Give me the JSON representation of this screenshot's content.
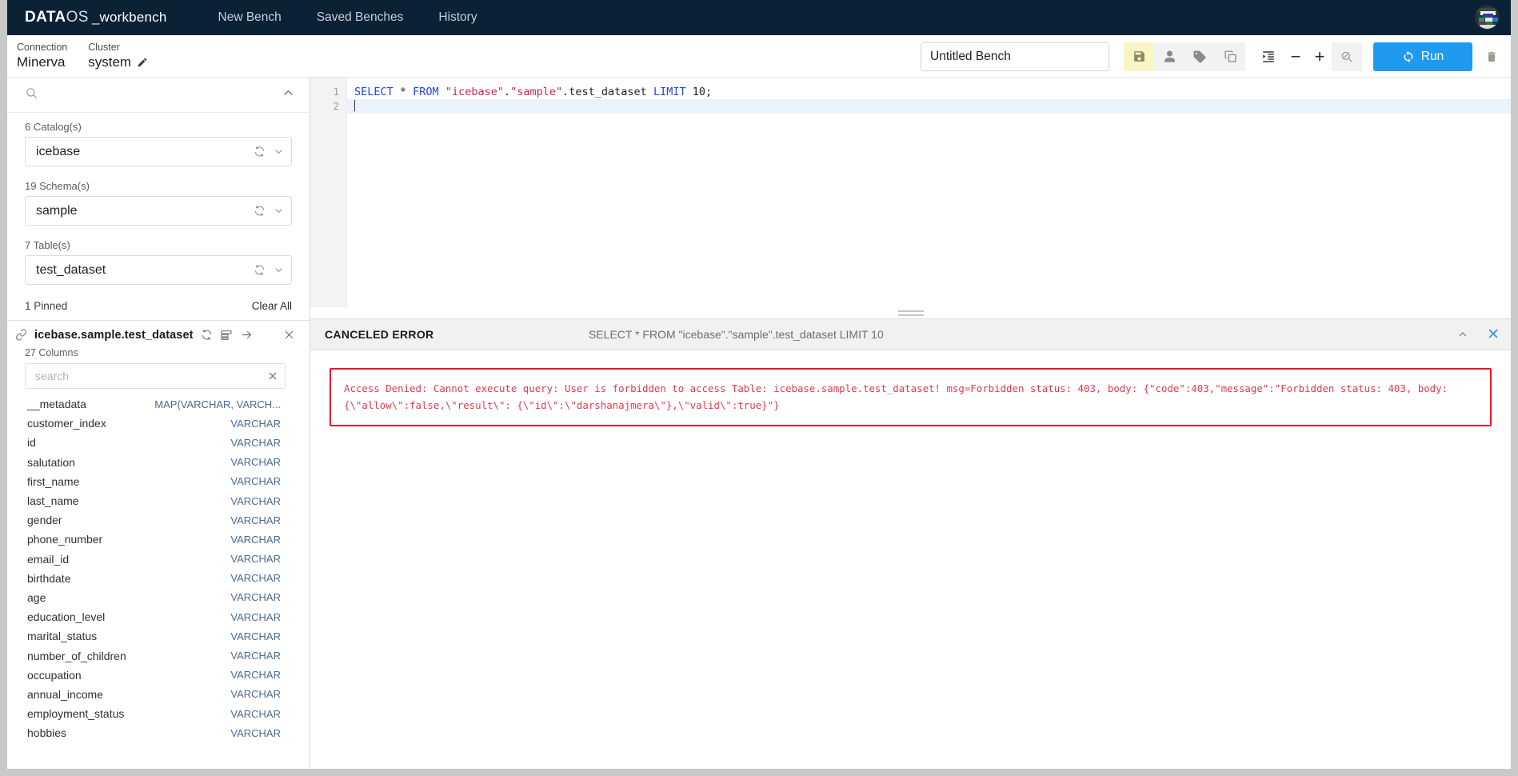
{
  "navbar": {
    "brand_data": "DATA",
    "brand_os": "OS",
    "brand_workbench": "_workbench",
    "links": [
      {
        "label": "New Bench"
      },
      {
        "label": "Saved Benches"
      },
      {
        "label": "History"
      }
    ],
    "avatar_name": "user-avatar"
  },
  "toolbar": {
    "connection_label": "Connection",
    "connection_value": "Minerva",
    "cluster_label": "Cluster",
    "cluster_value": "system",
    "bench_name_value": "Untitled Bench",
    "bench_name_placeholder": "Untitled Bench",
    "run_label": "Run",
    "icons": {
      "save": "save-icon",
      "share": "person-icon",
      "tag": "tag-icon",
      "copy": "copy-icon",
      "format": "format-indent-icon",
      "zoom_out": "minus-icon",
      "zoom_in": "plus-icon",
      "search_off": "search-off-icon",
      "run": "refresh-icon",
      "delete": "trash-icon"
    },
    "zoom_out_glyph": "−",
    "zoom_in_glyph": "+"
  },
  "sidebar": {
    "search_placeholder": "",
    "catalog": {
      "label": "6 Catalog(s)",
      "value": "icebase"
    },
    "schema": {
      "label": "19 Schema(s)",
      "value": "sample"
    },
    "table": {
      "label": "7 Table(s)",
      "value": "test_dataset"
    },
    "pinned_count": "1 Pinned",
    "clear_all": "Clear All",
    "pinned_table": {
      "name": "icebase.sample.test_dataset",
      "columns_count": "27 Columns",
      "search_placeholder": "search",
      "search_value": ""
    },
    "columns": [
      {
        "name": "__metadata",
        "type": "MAP(VARCHAR, VARCH..."
      },
      {
        "name": "customer_index",
        "type": "VARCHAR"
      },
      {
        "name": "id",
        "type": "VARCHAR"
      },
      {
        "name": "salutation",
        "type": "VARCHAR"
      },
      {
        "name": "first_name",
        "type": "VARCHAR"
      },
      {
        "name": "last_name",
        "type": "VARCHAR"
      },
      {
        "name": "gender",
        "type": "VARCHAR"
      },
      {
        "name": "phone_number",
        "type": "VARCHAR"
      },
      {
        "name": "email_id",
        "type": "VARCHAR"
      },
      {
        "name": "birthdate",
        "type": "VARCHAR"
      },
      {
        "name": "age",
        "type": "VARCHAR"
      },
      {
        "name": "education_level",
        "type": "VARCHAR"
      },
      {
        "name": "marital_status",
        "type": "VARCHAR"
      },
      {
        "name": "number_of_children",
        "type": "VARCHAR"
      },
      {
        "name": "occupation",
        "type": "VARCHAR"
      },
      {
        "name": "annual_income",
        "type": "VARCHAR"
      },
      {
        "name": "employment_status",
        "type": "VARCHAR"
      },
      {
        "name": "hobbies",
        "type": "VARCHAR"
      }
    ]
  },
  "editor": {
    "line_numbers": [
      "1",
      "2"
    ],
    "query_text": "SELECT * FROM \"icebase\".\"sample\".test_dataset LIMIT 10;",
    "tokens": [
      {
        "text": "SELECT ",
        "kind": "kw"
      },
      {
        "text": "* ",
        "kind": "plain"
      },
      {
        "text": "FROM ",
        "kind": "kw"
      },
      {
        "text": "\"icebase\"",
        "kind": "str"
      },
      {
        "text": ".",
        "kind": "plain"
      },
      {
        "text": "\"sample\"",
        "kind": "str"
      },
      {
        "text": ".test_dataset ",
        "kind": "plain"
      },
      {
        "text": "LIMIT ",
        "kind": "kw"
      },
      {
        "text": "10",
        "kind": "num"
      },
      {
        "text": ";",
        "kind": "plain"
      }
    ]
  },
  "results": {
    "status_title": "CANCELED ERROR",
    "query_echo": "SELECT * FROM \"icebase\".\"sample\".test_dataset LIMIT 10",
    "collapse_icon": "chevron-up-icon",
    "close_icon": "close-icon",
    "close_glyph": "✕",
    "error_message": "Access Denied: Cannot execute query: User is forbidden to access Table: icebase.sample.test_dataset! msg=Forbidden status: 403, body: {\"code\":403,\"message\":\"Forbidden status: 403, body: {\\\"allow\\\":false,\\\"result\\\": {\\\"id\\\":\\\"darshanajmera\\\"},\\\"valid\\\":true}\"}"
  },
  "colors": {
    "navbar_bg": "#0b2136",
    "accent_blue": "#1e9bf0",
    "error_red": "#e8192c",
    "save_yellow": "#fbf4c4"
  }
}
